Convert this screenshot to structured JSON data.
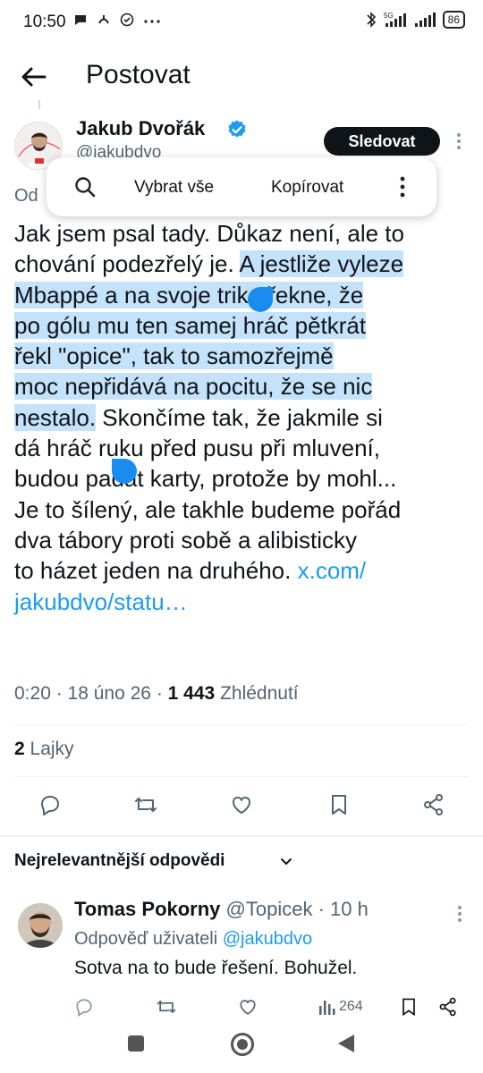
{
  "status_bar": {
    "time": "10:50",
    "battery": "86",
    "left_icons": [
      "chat-bubble-icon",
      "phone-transfer-icon",
      "check-circle-icon",
      "more-dots-icon"
    ],
    "right_icons": [
      "bluetooth-icon",
      "signal-5g-icon",
      "signal-icon",
      "battery-icon"
    ]
  },
  "header": {
    "title": "Postovat"
  },
  "author": {
    "name": "Jakub Dvořák",
    "handle": "@jakubdvo",
    "follow_label": "Sledovat",
    "partial_label": "Od"
  },
  "selection_menu": {
    "select_all": "Vybrat vše",
    "copy": "Kopírovat"
  },
  "tweet": {
    "lines": [
      {
        "parts": [
          {
            "text": "Jak jsem psal tady. Důkaz není, ale to",
            "style": "plain"
          }
        ]
      },
      {
        "parts": [
          {
            "text": "chování podezřelý je. ",
            "style": "plain"
          },
          {
            "text": "A jestliže vyleze",
            "style": "highlight"
          }
        ]
      },
      {
        "parts": [
          {
            "text": "Mbappé a na svoje triko řekne, že",
            "style": "highlight"
          }
        ]
      },
      {
        "parts": [
          {
            "text": "po gólu mu ten samej hráč pětkrát",
            "style": "highlight"
          }
        ]
      },
      {
        "parts": [
          {
            "text": "řekl \"opice\", tak to samozřejmě",
            "style": "highlight"
          }
        ]
      },
      {
        "parts": [
          {
            "text": "moc nepřidává na pocitu, že se nic",
            "style": "highlight"
          }
        ]
      },
      {
        "parts": [
          {
            "text": "nestalo.",
            "style": "highlight"
          },
          {
            "text": " Skončíme tak, že jakmile si",
            "style": "plain"
          }
        ]
      },
      {
        "parts": [
          {
            "text": "dá hráč ruku před pusu při mluvení,",
            "style": "plain"
          }
        ]
      },
      {
        "parts": [
          {
            "text": "budou padat karty, protože by mohl...",
            "style": "plain"
          }
        ]
      },
      {
        "parts": [
          {
            "text": "Je to šílený, ale takhle budeme pořád",
            "style": "plain"
          }
        ]
      },
      {
        "parts": [
          {
            "text": "dva tábory proti sobě a alibisticky",
            "style": "plain"
          }
        ]
      },
      {
        "parts": [
          {
            "text": "to házet jeden na druhého. ",
            "style": "plain"
          },
          {
            "text": "x.com/",
            "style": "link"
          }
        ]
      },
      {
        "parts": [
          {
            "text": "jakubdvo/statu…",
            "style": "link"
          }
        ]
      }
    ],
    "meta": {
      "time": "0:20",
      "date": "18 úno 26",
      "views_count": "1 443",
      "views_label": "Zhlédnutí"
    },
    "likes": {
      "count": "2",
      "label": "Lajky"
    }
  },
  "tweet_actions": [
    "reply-icon",
    "retweet-icon",
    "like-icon",
    "bookmark-icon",
    "share-icon"
  ],
  "replies_sort": {
    "label": "Nejrelevantnější odpovědi"
  },
  "reply": {
    "name": "Tomas Pokorny",
    "handle": "@Topicek",
    "time": "10 h",
    "reply_to_prefix": "Odpověď uživateli",
    "reply_to_handle": "@jakubdvo",
    "text": "Sotva na to bude řešení. Bohužel.",
    "views": "264"
  },
  "colors": {
    "accent": "#1d9bf0",
    "selection": "#c5e2fb",
    "text": "#0f1419",
    "secondary": "#536471"
  }
}
